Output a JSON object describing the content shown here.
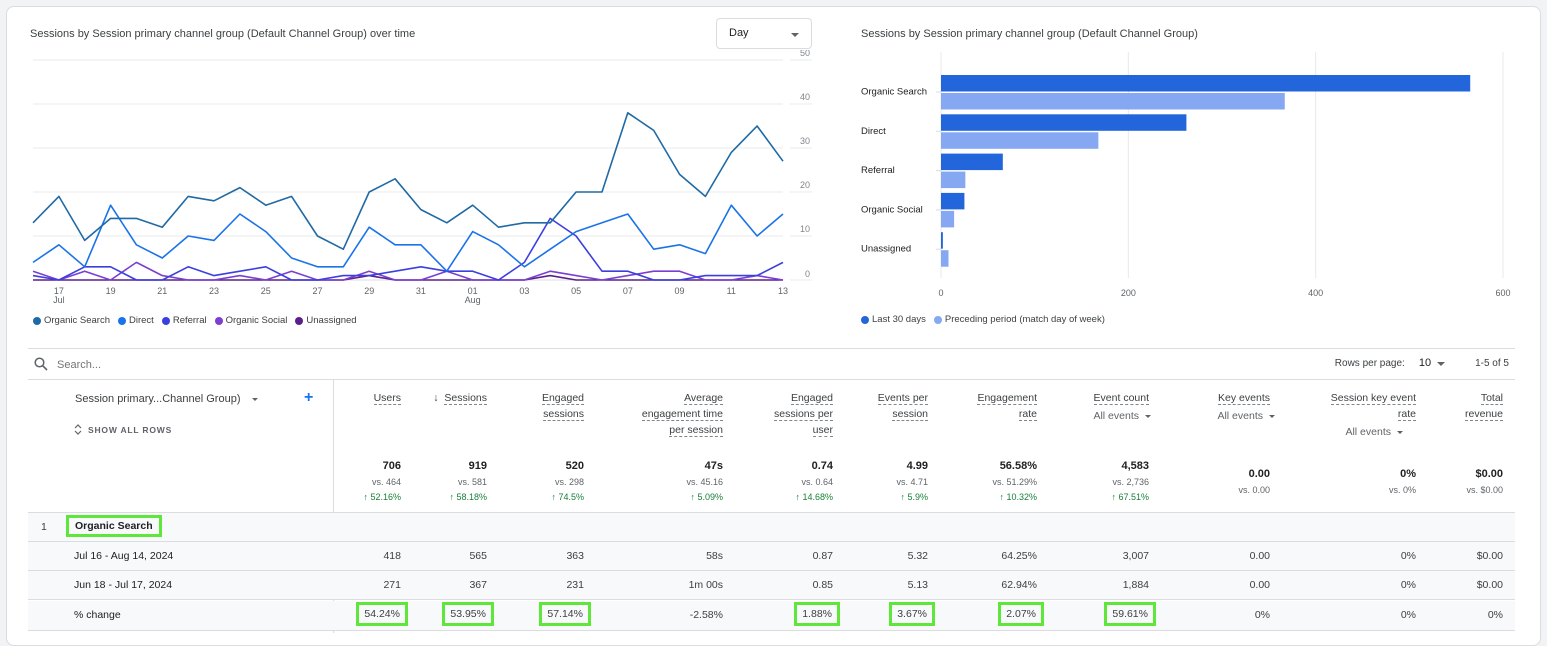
{
  "line_chart": {
    "title": "Sessions by Session primary channel group (Default Channel Group) over time",
    "granularity_select": "Day",
    "y_ticks": [
      "0",
      "10",
      "20",
      "30",
      "40",
      "50"
    ],
    "x_ticks": [
      {
        "label": "17",
        "sub": "Jul"
      },
      {
        "label": "19",
        "sub": ""
      },
      {
        "label": "21",
        "sub": ""
      },
      {
        "label": "23",
        "sub": ""
      },
      {
        "label": "25",
        "sub": ""
      },
      {
        "label": "27",
        "sub": ""
      },
      {
        "label": "29",
        "sub": ""
      },
      {
        "label": "31",
        "sub": ""
      },
      {
        "label": "01",
        "sub": "Aug"
      },
      {
        "label": "03",
        "sub": ""
      },
      {
        "label": "05",
        "sub": ""
      },
      {
        "label": "07",
        "sub": ""
      },
      {
        "label": "09",
        "sub": ""
      },
      {
        "label": "11",
        "sub": ""
      },
      {
        "label": "13",
        "sub": ""
      }
    ],
    "legend": [
      "Organic Search",
      "Direct",
      "Referral",
      "Organic Social",
      "Unassigned"
    ]
  },
  "bar_chart": {
    "title": "Sessions by Session primary channel group (Default Channel Group)",
    "legend": [
      "Last 30 days",
      "Preceding period (match day of week)"
    ]
  },
  "chart_data": [
    {
      "type": "line",
      "title": "Sessions by Session primary channel group (Default Channel Group) over time",
      "x": [
        "Jul 16",
        "Jul 17",
        "Jul 18",
        "Jul 19",
        "Jul 20",
        "Jul 21",
        "Jul 22",
        "Jul 23",
        "Jul 24",
        "Jul 25",
        "Jul 26",
        "Jul 27",
        "Jul 28",
        "Jul 29",
        "Jul 30",
        "Jul 31",
        "Aug 01",
        "Aug 02",
        "Aug 03",
        "Aug 04",
        "Aug 05",
        "Aug 06",
        "Aug 07",
        "Aug 08",
        "Aug 09",
        "Aug 10",
        "Aug 11",
        "Aug 12",
        "Aug 13",
        "Aug 14"
      ],
      "ylim": [
        0,
        50
      ],
      "y_axis_position": "right",
      "grid": true,
      "legend_position": "bottom-left",
      "series": [
        {
          "name": "Organic Search",
          "color": "#1f6aa5",
          "values": [
            13,
            19,
            9,
            14,
            14,
            12,
            19,
            18,
            21,
            17,
            19,
            10,
            7,
            20,
            23,
            16,
            13,
            17,
            12,
            13,
            13,
            20,
            20,
            38,
            34,
            24,
            19,
            29,
            35,
            27
          ]
        },
        {
          "name": "Direct",
          "color": "#1a73e8",
          "values": [
            4,
            8,
            3,
            17,
            8,
            5,
            10,
            9,
            15,
            11,
            5,
            3,
            3,
            12,
            8,
            8,
            2,
            11,
            8,
            3,
            7,
            11,
            13,
            15,
            7,
            8,
            6,
            17,
            10,
            15
          ]
        },
        {
          "name": "Referral",
          "color": "#3c3fe0",
          "values": [
            1,
            0,
            3,
            3,
            0,
            0,
            3,
            1,
            2,
            3,
            0,
            0,
            1,
            1,
            2,
            3,
            2,
            2,
            0,
            4,
            14,
            10,
            2,
            2,
            0,
            0,
            1,
            1,
            1,
            4
          ]
        },
        {
          "name": "Organic Social",
          "color": "#7b3fd1",
          "values": [
            2,
            0,
            2,
            0,
            4,
            1,
            0,
            0,
            1,
            0,
            2,
            0,
            0,
            2,
            0,
            0,
            2,
            0,
            0,
            0,
            2,
            1,
            0,
            1,
            2,
            2,
            0,
            0,
            1,
            0
          ]
        },
        {
          "name": "Unassigned",
          "color": "#5b1f8a",
          "values": [
            0,
            0,
            0,
            0,
            0,
            0,
            0,
            0,
            0,
            0,
            0,
            0,
            0,
            1,
            0,
            0,
            0,
            0,
            0,
            0,
            1,
            0,
            0,
            0,
            0,
            0,
            0,
            0,
            0,
            0
          ]
        }
      ]
    },
    {
      "type": "bar",
      "orientation": "horizontal",
      "title": "Sessions by Session primary channel group (Default Channel Group)",
      "categories": [
        "Organic Search",
        "Direct",
        "Referral",
        "Organic Social",
        "Unassigned"
      ],
      "xlim": [
        0,
        600
      ],
      "x_ticks": [
        "0",
        "200",
        "400",
        "600"
      ],
      "grid": true,
      "legend_position": "bottom-left",
      "series": [
        {
          "name": "Last 30 days",
          "color": "#2366dc",
          "values": [
            565,
            262,
            66,
            25,
            2
          ]
        },
        {
          "name": "Preceding period (match day of week)",
          "color": "#86a8f2",
          "values": [
            367,
            168,
            26,
            14,
            8
          ]
        }
      ]
    }
  ],
  "table": {
    "search_placeholder": "Search...",
    "rows_per_page_label": "Rows per page:",
    "rows_per_page_value": "10",
    "pagination": "1-5 of 5",
    "dimension_header": "Session primary...Channel Group)",
    "show_all_rows": "SHOW ALL ROWS",
    "columns": [
      {
        "lines": [
          "Users"
        ],
        "sub": "",
        "total": "706",
        "vs": "vs. 464",
        "change": "↑ 52.16%"
      },
      {
        "lines": [
          "Sessions"
        ],
        "sub": "",
        "sorted": true,
        "total": "919",
        "vs": "vs. 581",
        "change": "↑ 58.18%"
      },
      {
        "lines": [
          "Engaged",
          "sessions"
        ],
        "sub": "",
        "total": "520",
        "vs": "vs. 298",
        "change": "↑ 74.5%"
      },
      {
        "lines": [
          "Average",
          "engagement time",
          "per session"
        ],
        "sub": "",
        "total": "47s",
        "vs": "vs. 45.16",
        "change": "↑ 5.09%"
      },
      {
        "lines": [
          "Engaged",
          "sessions per",
          "user"
        ],
        "sub": "",
        "total": "0.74",
        "vs": "vs. 0.64",
        "change": "↑ 14.68%"
      },
      {
        "lines": [
          "Events per",
          "session"
        ],
        "sub": "",
        "total": "4.99",
        "vs": "vs. 4.71",
        "change": "↑ 5.9%"
      },
      {
        "lines": [
          "Engagement",
          "rate"
        ],
        "sub": "",
        "total": "56.58%",
        "vs": "vs. 51.29%",
        "change": "↑ 10.32%"
      },
      {
        "lines": [
          "Event count"
        ],
        "sub": "All events",
        "total": "4,583",
        "vs": "vs. 2,736",
        "change": "↑ 67.51%"
      },
      {
        "lines": [
          "Key events"
        ],
        "sub": "All events",
        "total": "0.00",
        "vs": "vs. 0.00",
        "change": ""
      },
      {
        "lines": [
          "Session key event",
          "rate"
        ],
        "sub": "All events",
        "total": "0%",
        "vs": "vs. 0%",
        "change": ""
      },
      {
        "lines": [
          "Total",
          "revenue"
        ],
        "sub": "",
        "total": "$0.00",
        "vs": "vs. $0.00",
        "change": ""
      }
    ],
    "group": {
      "index": "1",
      "name": "Organic Search"
    },
    "rows": [
      {
        "label": "Jul 16 - Aug 14, 2024",
        "values": [
          "418",
          "565",
          "363",
          "58s",
          "0.87",
          "5.32",
          "64.25%",
          "3,007",
          "0.00",
          "0%",
          "$0.00"
        ]
      },
      {
        "label": "Jun 18 - Jul 17, 2024",
        "values": [
          "271",
          "367",
          "231",
          "1m 00s",
          "0.85",
          "5.13",
          "62.94%",
          "1,884",
          "0.00",
          "0%",
          "$0.00"
        ]
      },
      {
        "label": "% change",
        "values": [
          "54.24%",
          "53.95%",
          "57.14%",
          "-2.58%",
          "1.88%",
          "3.67%",
          "2.07%",
          "59.61%",
          "0%",
          "0%",
          "0%"
        ],
        "highlighted": [
          true,
          true,
          true,
          false,
          true,
          true,
          true,
          true,
          false,
          false,
          false
        ]
      }
    ]
  }
}
